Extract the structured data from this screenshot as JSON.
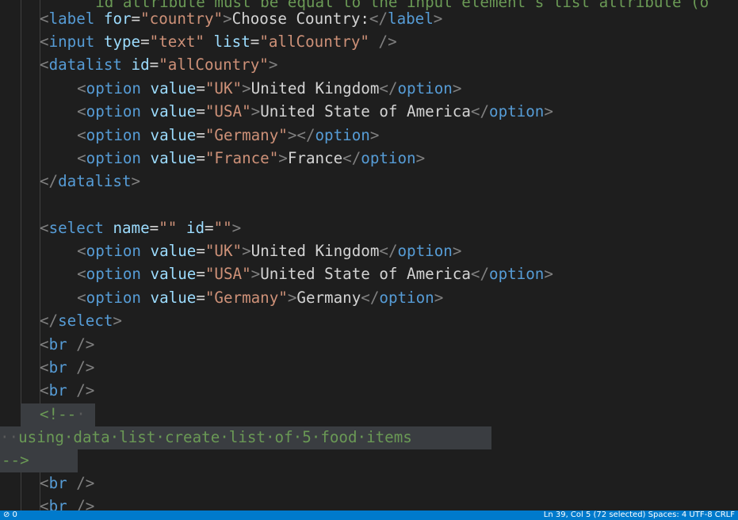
{
  "editor": {
    "lines": [
      {
        "tokens": [
          {
            "t": "ws",
            "v": "    "
          },
          {
            "t": "cmt",
            "v": "id attribute must be equal to the input element's list attribute (o"
          }
        ]
      },
      {
        "tokens": [
          {
            "t": "br",
            "v": "<"
          },
          {
            "t": "tag",
            "v": "label"
          },
          {
            "t": "txt",
            "v": " "
          },
          {
            "t": "attr",
            "v": "for"
          },
          {
            "t": "txt",
            "v": "="
          },
          {
            "t": "str",
            "v": "\"country\""
          },
          {
            "t": "br",
            "v": ">"
          },
          {
            "t": "txt",
            "v": "Choose Country:"
          },
          {
            "t": "br",
            "v": "</"
          },
          {
            "t": "tag",
            "v": "label"
          },
          {
            "t": "br",
            "v": ">"
          }
        ]
      },
      {
        "tokens": [
          {
            "t": "br",
            "v": "<"
          },
          {
            "t": "tag",
            "v": "input"
          },
          {
            "t": "txt",
            "v": " "
          },
          {
            "t": "attr",
            "v": "type"
          },
          {
            "t": "txt",
            "v": "="
          },
          {
            "t": "str",
            "v": "\"text\""
          },
          {
            "t": "txt",
            "v": " "
          },
          {
            "t": "attr",
            "v": "list"
          },
          {
            "t": "txt",
            "v": "="
          },
          {
            "t": "str",
            "v": "\"allCountry\""
          },
          {
            "t": "txt",
            "v": " "
          },
          {
            "t": "br",
            "v": "/>"
          }
        ]
      },
      {
        "tokens": [
          {
            "t": "br",
            "v": "<"
          },
          {
            "t": "tag",
            "v": "datalist"
          },
          {
            "t": "txt",
            "v": " "
          },
          {
            "t": "attr",
            "v": "id"
          },
          {
            "t": "txt",
            "v": "="
          },
          {
            "t": "str",
            "v": "\"allCountry\""
          },
          {
            "t": "br",
            "v": ">"
          }
        ]
      },
      {
        "tokens": [
          {
            "t": "ws",
            "v": "  "
          },
          {
            "t": "br",
            "v": "<"
          },
          {
            "t": "tag",
            "v": "option"
          },
          {
            "t": "txt",
            "v": " "
          },
          {
            "t": "attr",
            "v": "value"
          },
          {
            "t": "txt",
            "v": "="
          },
          {
            "t": "str",
            "v": "\"UK\""
          },
          {
            "t": "br",
            "v": ">"
          },
          {
            "t": "txt",
            "v": "United Kingdom"
          },
          {
            "t": "br",
            "v": "</"
          },
          {
            "t": "tag",
            "v": "option"
          },
          {
            "t": "br",
            "v": ">"
          }
        ]
      },
      {
        "tokens": [
          {
            "t": "ws",
            "v": "  "
          },
          {
            "t": "br",
            "v": "<"
          },
          {
            "t": "tag",
            "v": "option"
          },
          {
            "t": "txt",
            "v": " "
          },
          {
            "t": "attr",
            "v": "value"
          },
          {
            "t": "txt",
            "v": "="
          },
          {
            "t": "str",
            "v": "\"USA\""
          },
          {
            "t": "br",
            "v": ">"
          },
          {
            "t": "txt",
            "v": "United State of America"
          },
          {
            "t": "br",
            "v": "</"
          },
          {
            "t": "tag",
            "v": "option"
          },
          {
            "t": "br",
            "v": ">"
          }
        ]
      },
      {
        "tokens": [
          {
            "t": "ws",
            "v": "  "
          },
          {
            "t": "br",
            "v": "<"
          },
          {
            "t": "tag",
            "v": "option"
          },
          {
            "t": "txt",
            "v": " "
          },
          {
            "t": "attr",
            "v": "value"
          },
          {
            "t": "txt",
            "v": "="
          },
          {
            "t": "str",
            "v": "\"Germany\""
          },
          {
            "t": "br",
            "v": "></"
          },
          {
            "t": "tag",
            "v": "option"
          },
          {
            "t": "br",
            "v": ">"
          }
        ]
      },
      {
        "tokens": [
          {
            "t": "ws",
            "v": "  "
          },
          {
            "t": "br",
            "v": "<"
          },
          {
            "t": "tag",
            "v": "option"
          },
          {
            "t": "txt",
            "v": " "
          },
          {
            "t": "attr",
            "v": "value"
          },
          {
            "t": "txt",
            "v": "="
          },
          {
            "t": "str",
            "v": "\"France\""
          },
          {
            "t": "br",
            "v": ">"
          },
          {
            "t": "txt",
            "v": "France"
          },
          {
            "t": "br",
            "v": "</"
          },
          {
            "t": "tag",
            "v": "option"
          },
          {
            "t": "br",
            "v": ">"
          }
        ]
      },
      {
        "tokens": [
          {
            "t": "br",
            "v": "</"
          },
          {
            "t": "tag",
            "v": "datalist"
          },
          {
            "t": "br",
            "v": ">"
          }
        ]
      },
      {
        "tokens": []
      },
      {
        "tokens": [
          {
            "t": "br",
            "v": "<"
          },
          {
            "t": "tag",
            "v": "select"
          },
          {
            "t": "txt",
            "v": " "
          },
          {
            "t": "attr",
            "v": "name"
          },
          {
            "t": "txt",
            "v": "="
          },
          {
            "t": "str",
            "v": "\"\""
          },
          {
            "t": "txt",
            "v": " "
          },
          {
            "t": "attr",
            "v": "id"
          },
          {
            "t": "txt",
            "v": "="
          },
          {
            "t": "str",
            "v": "\"\""
          },
          {
            "t": "br",
            "v": ">"
          }
        ]
      },
      {
        "tokens": [
          {
            "t": "ws",
            "v": "  "
          },
          {
            "t": "br",
            "v": "<"
          },
          {
            "t": "tag",
            "v": "option"
          },
          {
            "t": "txt",
            "v": " "
          },
          {
            "t": "attr",
            "v": "value"
          },
          {
            "t": "txt",
            "v": "="
          },
          {
            "t": "str",
            "v": "\"UK\""
          },
          {
            "t": "br",
            "v": ">"
          },
          {
            "t": "txt",
            "v": "United Kingdom"
          },
          {
            "t": "br",
            "v": "</"
          },
          {
            "t": "tag",
            "v": "option"
          },
          {
            "t": "br",
            "v": ">"
          }
        ]
      },
      {
        "tokens": [
          {
            "t": "ws",
            "v": "  "
          },
          {
            "t": "br",
            "v": "<"
          },
          {
            "t": "tag",
            "v": "option"
          },
          {
            "t": "txt",
            "v": " "
          },
          {
            "t": "attr",
            "v": "value"
          },
          {
            "t": "txt",
            "v": "="
          },
          {
            "t": "str",
            "v": "\"USA\""
          },
          {
            "t": "br",
            "v": ">"
          },
          {
            "t": "txt",
            "v": "United State of America"
          },
          {
            "t": "br",
            "v": "</"
          },
          {
            "t": "tag",
            "v": "option"
          },
          {
            "t": "br",
            "v": ">"
          }
        ]
      },
      {
        "tokens": [
          {
            "t": "ws",
            "v": "  "
          },
          {
            "t": "br",
            "v": "<"
          },
          {
            "t": "tag",
            "v": "option"
          },
          {
            "t": "txt",
            "v": " "
          },
          {
            "t": "attr",
            "v": "value"
          },
          {
            "t": "txt",
            "v": "="
          },
          {
            "t": "str",
            "v": "\"Germany\""
          },
          {
            "t": "br",
            "v": ">"
          },
          {
            "t": "txt",
            "v": "Germany"
          },
          {
            "t": "br",
            "v": "</"
          },
          {
            "t": "tag",
            "v": "option"
          },
          {
            "t": "br",
            "v": ">"
          }
        ]
      },
      {
        "tokens": [
          {
            "t": "br",
            "v": "</"
          },
          {
            "t": "tag",
            "v": "select"
          },
          {
            "t": "br",
            "v": ">"
          }
        ]
      },
      {
        "tokens": [
          {
            "t": "br",
            "v": "<"
          },
          {
            "t": "tag",
            "v": "br"
          },
          {
            "t": "txt",
            "v": " "
          },
          {
            "t": "br",
            "v": "/>"
          }
        ]
      },
      {
        "tokens": [
          {
            "t": "br",
            "v": "<"
          },
          {
            "t": "tag",
            "v": "br"
          },
          {
            "t": "txt",
            "v": " "
          },
          {
            "t": "br",
            "v": "/>"
          }
        ]
      },
      {
        "tokens": [
          {
            "t": "br",
            "v": "<"
          },
          {
            "t": "tag",
            "v": "br"
          },
          {
            "t": "txt",
            "v": " "
          },
          {
            "t": "br",
            "v": "/>"
          }
        ]
      },
      {
        "tokens": [
          {
            "t": "cmt",
            "v": "<!--"
          },
          {
            "t": "ws",
            "v": "·"
          }
        ]
      },
      {
        "tokens": [
          {
            "t": "ws",
            "v": "··"
          },
          {
            "t": "cmt",
            "v": "using·data·list·create·list·of·5·food·items"
          }
        ]
      },
      {
        "tokens": [
          {
            "t": "cmt",
            "v": "-->"
          }
        ]
      },
      {
        "tokens": [
          {
            "t": "br",
            "v": "<"
          },
          {
            "t": "tag",
            "v": "br"
          },
          {
            "t": "txt",
            "v": " "
          },
          {
            "t": "br",
            "v": "/>"
          }
        ]
      },
      {
        "tokens": [
          {
            "t": "br",
            "v": "<"
          },
          {
            "t": "tag",
            "v": "br"
          },
          {
            "t": "txt",
            "v": " "
          },
          {
            "t": "br",
            "v": "/>"
          }
        ]
      }
    ]
  },
  "status_bar": {
    "left": "⊘ 0",
    "right": "Ln 39, Col 5 (72 selected)    Spaces: 4    UTF-8    CRLF"
  }
}
